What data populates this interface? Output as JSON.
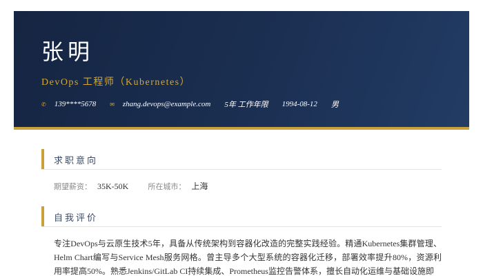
{
  "profile": {
    "name": "张明",
    "title": "DevOps 工程师（Kubernetes）",
    "contacts": [
      {
        "icon": "phone-icon",
        "glyph": "✆",
        "text": "139****5678"
      },
      {
        "icon": "email-icon",
        "glyph": "✉",
        "text": "zhang.devops@example.com"
      },
      {
        "icon": "",
        "glyph": "",
        "text": "5年 工作年限"
      },
      {
        "icon": "",
        "glyph": "",
        "text": "1994-08-12"
      },
      {
        "icon": "",
        "glyph": "",
        "text": "男"
      }
    ]
  },
  "sections": {
    "intent": {
      "title": "求职意向",
      "salary_label": "期望薪资：",
      "salary_value": "35K-50K",
      "city_label": "所在城市：",
      "city_value": "上海"
    },
    "summary": {
      "title": "自我评价",
      "text": "专注DevOps与云原生技术5年，具备从传统架构到容器化改造的完整实践经验。精通Kubernetes集群管理、Helm Chart编写与Service Mesh服务网格。曾主导多个大型系统的容器化迁移，部署效率提升80%，资源利用率提高50%。熟悉Jenkins/GitLab CI持续集成、Prometheus监控告警体系，擅长自动化运维与基础设施即"
    }
  },
  "colors": {
    "header_bg": "#1b2f52",
    "accent_gold": "#c9a03a",
    "section_title": "#3b4a64",
    "body_text": "#333333"
  }
}
